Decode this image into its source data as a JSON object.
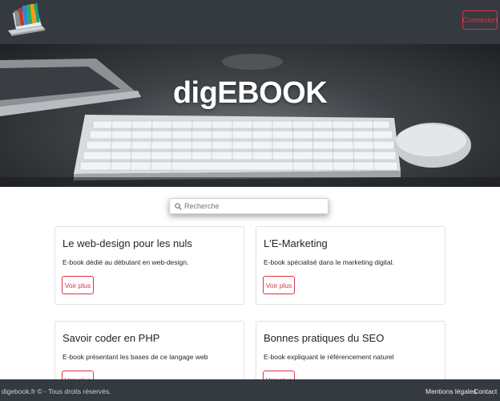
{
  "header": {
    "logo_icon": "ebook-books-laptop-icon",
    "login_label": "Connexion"
  },
  "hero": {
    "title": "digEBOOK"
  },
  "search": {
    "placeholder": "Recherche",
    "icon": "search-icon"
  },
  "cards": [
    {
      "title": "Le web-design pour les nuls",
      "text": "E-book dédié au débutant en web-design.",
      "button": "Voir plus"
    },
    {
      "title": "L'E-Marketing",
      "text": "E-book spécialisé dans le marketing digital.",
      "button": "Voir plus"
    },
    {
      "title": "Savoir coder en PHP",
      "text": "E-book présentant les bases de ce langage web",
      "button": "Voir plus"
    },
    {
      "title": "Bonnes pratiques du SEO",
      "text": "E-book expliquant le référencement naturel",
      "button": "Voir plus"
    }
  ],
  "footer": {
    "copyright": "digebook.fr © - Tous droits réservés.",
    "legal": "Mentions légales",
    "contact": "Contact"
  },
  "colors": {
    "navbar": "#343a40",
    "accent": "#dc3545"
  }
}
